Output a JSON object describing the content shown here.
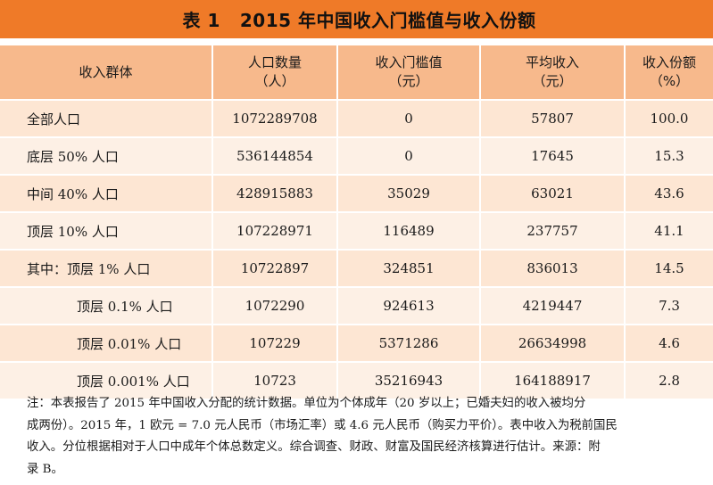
{
  "title": {
    "label": "表 1",
    "text": "2015 年中国收入门槛值与收入份额"
  },
  "table": {
    "headers": [
      [
        "收入群体",
        ""
      ],
      [
        "人口数量",
        "（人）"
      ],
      [
        "收入门槛值",
        "（元）"
      ],
      [
        "平均收入",
        "（元）"
      ],
      [
        "收入份额",
        "（%）"
      ]
    ],
    "rows": [
      {
        "group": "全部人口",
        "population": "1072289708",
        "threshold": "0",
        "avg": "57807",
        "share": "100.0"
      },
      {
        "group": "底层 50% 人口",
        "population": "536144854",
        "threshold": "0",
        "avg": "17645",
        "share": "15.3"
      },
      {
        "group": "中间 40% 人口",
        "population": "428915883",
        "threshold": "35029",
        "avg": "63021",
        "share": "43.6"
      },
      {
        "group": "顶层 10% 人口",
        "population": "107228971",
        "threshold": "116489",
        "avg": "237757",
        "share": "41.1"
      },
      {
        "group": "其中：顶层 1% 人口",
        "population": "10722897",
        "threshold": "324851",
        "avg": "836013",
        "share": "14.5"
      },
      {
        "group": "顶层 0.1% 人口",
        "population": "1072290",
        "threshold": "924613",
        "avg": "4219447",
        "share": "7.3"
      },
      {
        "group": "顶层 0.01% 人口",
        "population": "107229",
        "threshold": "5371286",
        "avg": "26634998",
        "share": "4.6"
      },
      {
        "group": "顶层 0.001% 人口",
        "population": "10723",
        "threshold": "35216943",
        "avg": "164188917",
        "share": "2.8"
      }
    ]
  },
  "note": {
    "line1": "注：本表报告了 2015 年中国收入分配的统计数据。单位为个体成年（20 岁以上；已婚夫妇的收入被均分",
    "line2": "成两份）。2015 年，1 欧元 = 7.0 元人民币（市场汇率）或 4.6 元人民币（购买力平价）。表中收入为税前国民",
    "line3": "收入。分位根据相对于人口中成年个体总数定义。综合调查、财政、财富及国民经济核算进行估计。来源：附",
    "line4": "录 B。"
  },
  "colors": {
    "title_bg": "#ef7a28",
    "header_bg": "#f7b98c",
    "row_bg": "#fde6d3",
    "row_alt_bg": "#fdf0e5"
  }
}
